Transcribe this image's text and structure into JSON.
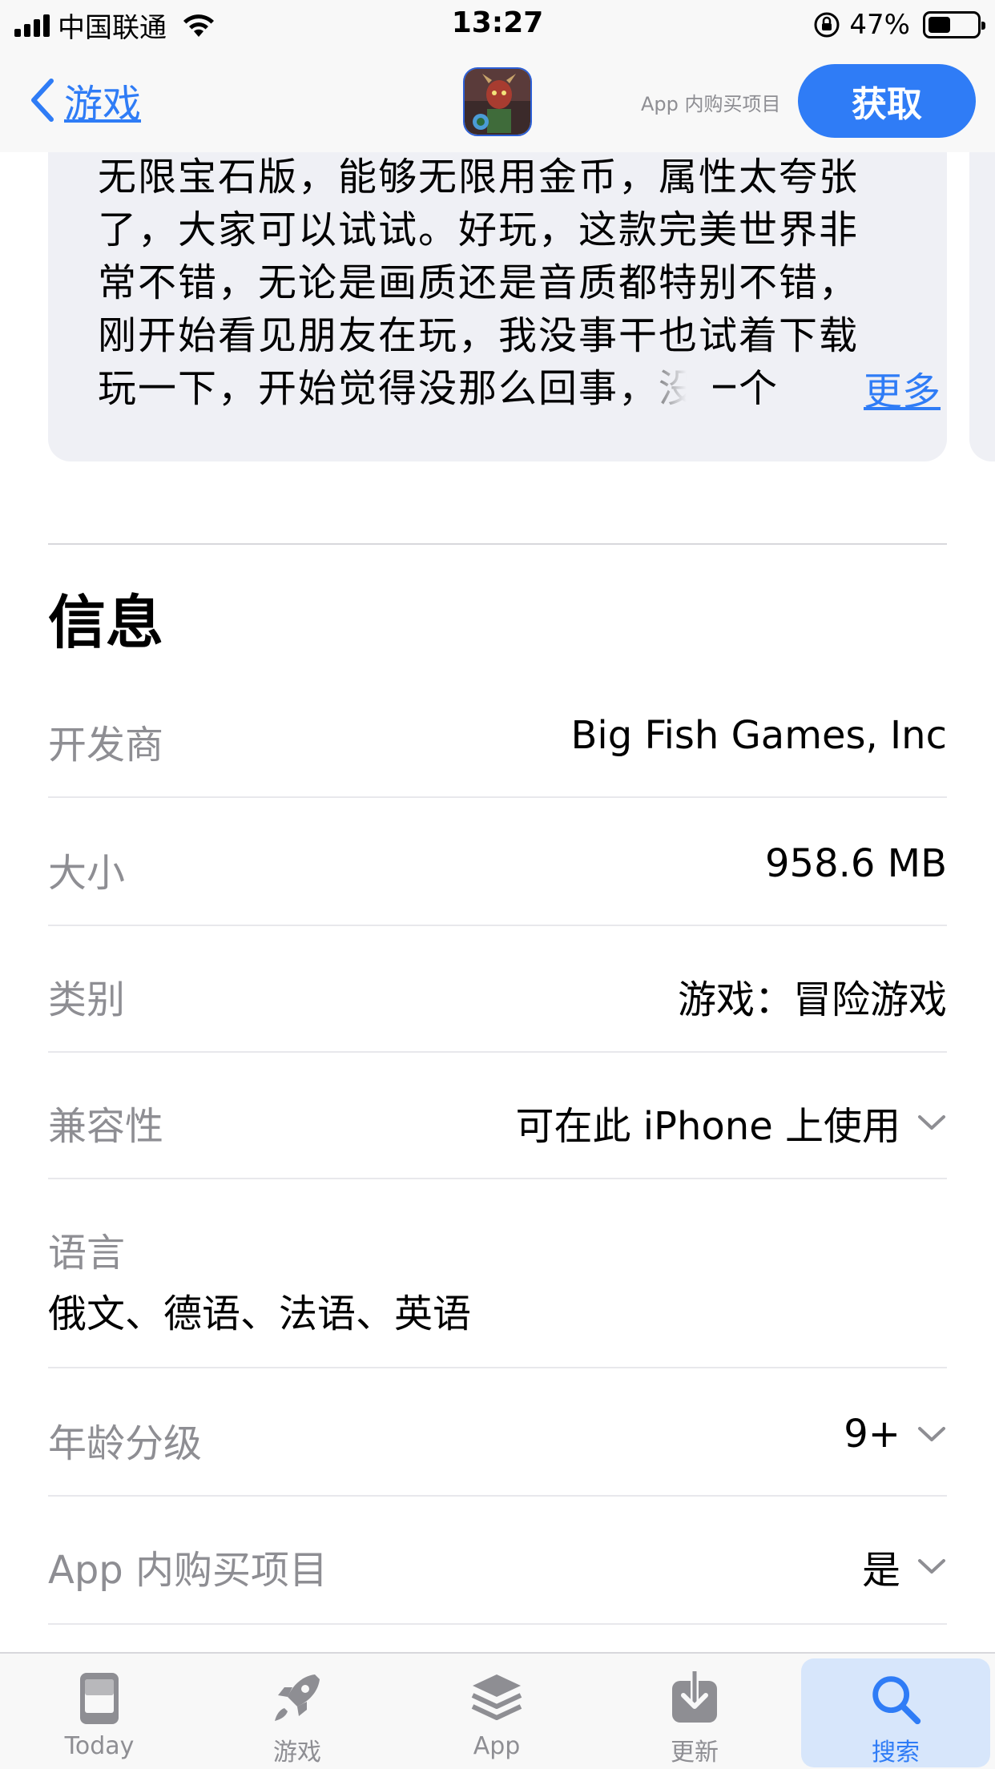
{
  "status_bar": {
    "carrier": "中国联通",
    "time": "13:27",
    "battery_percent": "47%",
    "battery_level": 0.47
  },
  "nav": {
    "back_label": "游戏",
    "iap_note": "App 内购买项目",
    "get_label": "获取"
  },
  "review": {
    "lines": [
      "无限宝石版，能够无限用金币，属性太夸张",
      "了，大家可以试试。好玩，这款完美世界非",
      "常不错，无论是画质还是音质都特别不错，",
      "刚开始看见朋友在玩，我没事干也试着下载",
      "玩一下，开始觉得没那么回事，没一个"
    ],
    "more_label": "更多"
  },
  "info": {
    "title": "信息",
    "developer": {
      "label": "开发商",
      "value": "Big Fish Games, Inc"
    },
    "size": {
      "label": "大小",
      "value": "958.6 MB"
    },
    "category": {
      "label": "类别",
      "value": "游戏：冒险游戏"
    },
    "compatibility": {
      "label": "兼容性",
      "value": "可在此 iPhone 上使用"
    },
    "languages": {
      "label": "语言",
      "value": "俄文、德语、法语、英语"
    },
    "age_rating": {
      "label": "年龄分级",
      "value": "9+"
    },
    "in_app_purchases": {
      "label": "App 内购买项目",
      "value": "是"
    }
  },
  "tab_bar": {
    "today": "Today",
    "games": "游戏",
    "apps": "App",
    "updates": "更新",
    "search": "搜索",
    "active": "search"
  },
  "colors": {
    "accent": "#2f7cf6",
    "secondary_text": "#8e8e93",
    "card_bg": "#eff0f5"
  }
}
